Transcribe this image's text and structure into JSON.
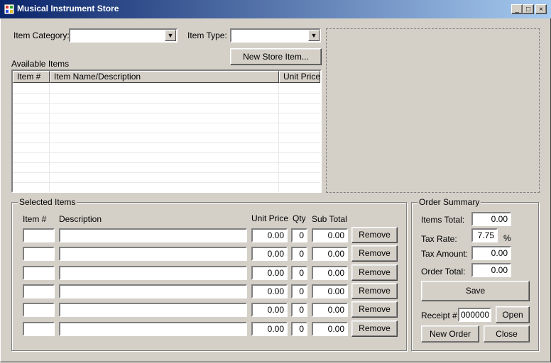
{
  "window": {
    "title": "Musical Instrument Store",
    "minimize": "_",
    "maximize": "□",
    "close": "×"
  },
  "filters": {
    "category_label": "Item Category:",
    "type_label": "Item Type:",
    "category_value": "",
    "type_value": ""
  },
  "new_store_item_button": "New Store Item...",
  "available_items": {
    "label": "Available Items",
    "columns": [
      "Item #",
      "Item Name/Description",
      "Unit Price"
    ]
  },
  "selected_items": {
    "title": "Selected Items",
    "headers": {
      "item": "Item #",
      "description": "Description",
      "unit_price": "Unit Price",
      "qty": "Qty",
      "subtotal": "Sub Total"
    },
    "remove_label": "Remove",
    "rows": [
      {
        "item": "",
        "description": "",
        "unit_price": "0.00",
        "qty": "0",
        "subtotal": "0.00"
      },
      {
        "item": "",
        "description": "",
        "unit_price": "0.00",
        "qty": "0",
        "subtotal": "0.00"
      },
      {
        "item": "",
        "description": "",
        "unit_price": "0.00",
        "qty": "0",
        "subtotal": "0.00"
      },
      {
        "item": "",
        "description": "",
        "unit_price": "0.00",
        "qty": "0",
        "subtotal": "0.00"
      },
      {
        "item": "",
        "description": "",
        "unit_price": "0.00",
        "qty": "0",
        "subtotal": "0.00"
      },
      {
        "item": "",
        "description": "",
        "unit_price": "0.00",
        "qty": "0",
        "subtotal": "0.00"
      }
    ]
  },
  "order_summary": {
    "title": "Order Summary",
    "items_total_label": "Items Total:",
    "items_total": "0.00",
    "tax_rate_label": "Tax Rate:",
    "tax_rate": "7.75",
    "tax_rate_unit": "%",
    "tax_amount_label": "Tax Amount:",
    "tax_amount": "0.00",
    "order_total_label": "Order Total:",
    "order_total": "0.00",
    "save_label": "Save",
    "receipt_label": "Receipt #:",
    "receipt_value": "000000",
    "open_label": "Open",
    "new_order_label": "New Order",
    "close_label": "Close"
  }
}
